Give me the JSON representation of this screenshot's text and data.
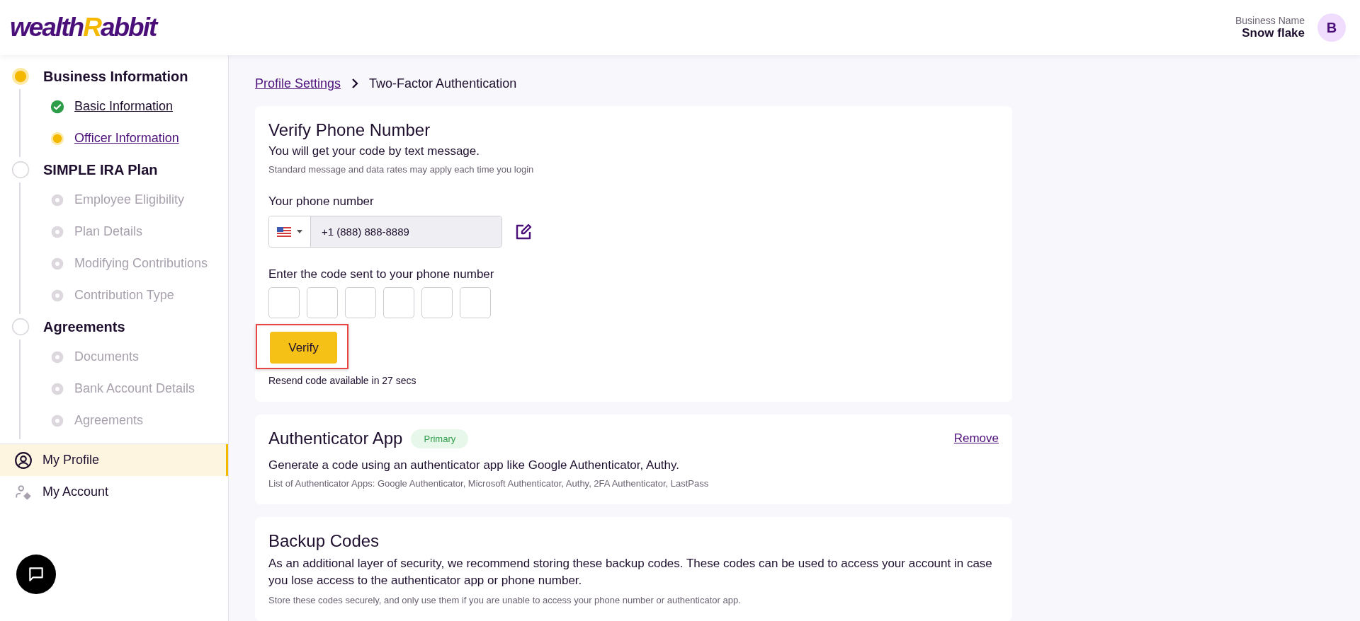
{
  "header": {
    "logo": {
      "text": "wealth",
      "accent": "R",
      "rest": "abbit"
    },
    "business_label": "Business Name",
    "business_name": "Snow flake",
    "avatar": "B"
  },
  "sidebar": {
    "sections": [
      {
        "title": "Business Information",
        "active": true,
        "children": [
          {
            "label": "Basic Information",
            "done": true,
            "active": false
          },
          {
            "label": "Officer Information",
            "done": false,
            "active": true
          }
        ]
      },
      {
        "title": "SIMPLE IRA Plan",
        "active": false,
        "children": [
          {
            "label": "Employee Eligibility",
            "done": false,
            "active": false
          },
          {
            "label": "Plan Details",
            "done": false,
            "active": false
          },
          {
            "label": "Modifying Contributions",
            "done": false,
            "active": false
          },
          {
            "label": "Contribution Type",
            "done": false,
            "active": false
          }
        ]
      },
      {
        "title": "Agreements",
        "active": false,
        "children": [
          {
            "label": "Documents",
            "done": false,
            "active": false
          },
          {
            "label": "Bank Account Details",
            "done": false,
            "active": false
          },
          {
            "label": "Agreements",
            "done": false,
            "active": false
          }
        ]
      }
    ],
    "nav": [
      {
        "label": "My Profile",
        "kind": "profile",
        "selected": true
      },
      {
        "label": "My Account",
        "kind": "account",
        "selected": false
      }
    ]
  },
  "breadcrumb": [
    {
      "label": "Profile Settings",
      "kind": "link"
    },
    {
      "label": "Two-Factor Authentication",
      "kind": "current"
    }
  ],
  "verify_card": {
    "title": "Verify Phone Number",
    "subtitle": "You will get your code by text message.",
    "note": "Standard message and data rates may apply each time you login",
    "phone_label": "Your phone number",
    "phone_value": "+1 (888) 888-8889",
    "code_label": "Enter the code sent to your phone number",
    "code_fields": [
      {
        "filled": false
      },
      {
        "filled": false
      },
      {
        "filled": false
      },
      {
        "filled": false
      },
      {
        "filled": false
      },
      {
        "filled": false
      }
    ],
    "button": {
      "label": "Verify",
      "highlighted": true
    },
    "resend": "Resend code available in 27 secs"
  },
  "authenticator_card": {
    "title": "Authenticator App",
    "badge": "Primary",
    "action": "Remove",
    "description": "Generate a code using an authenticator app like Google Authenticator, Authy.",
    "note": "List of Authenticator Apps: Google Authenticator, Microsoft Authenticator, Authy, 2FA Authenticator, LastPass"
  },
  "backup_card": {
    "title": "Backup Codes",
    "description": "As an additional layer of security, we recommend storing these backup codes. These codes can be used to access your account in case you lose access to the authenticator app or phone number.",
    "note": "Store these codes securely, and only use them if you are unable to access your phone number or authenticator app."
  }
}
